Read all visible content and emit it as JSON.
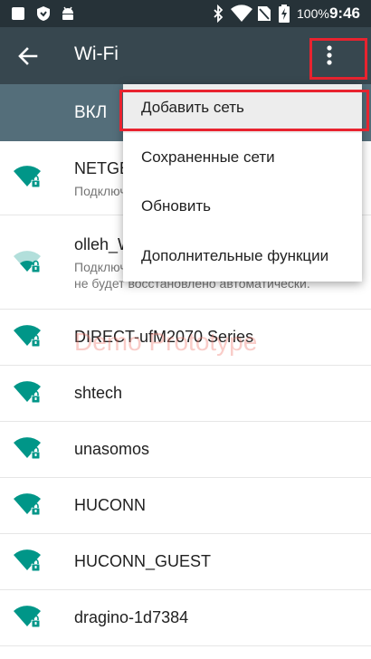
{
  "status_bar": {
    "icons": [
      "notification-icon",
      "shield-icon",
      "android-icon",
      "bluetooth-icon",
      "wifi-icon",
      "no-sim-icon",
      "battery-charging-icon"
    ],
    "battery": "100%",
    "time": "9:46"
  },
  "app_bar": {
    "title": "Wi-Fi",
    "back_icon": "arrow-back-icon",
    "overflow_icon": "more-vert-icon"
  },
  "switch": {
    "label": "ВКЛ"
  },
  "networks": [
    {
      "name": "NETGEAR",
      "status": "Подключ",
      "signal": "full",
      "locked": true
    },
    {
      "name": "olleh_WiFi",
      "status": "Подключ",
      "status_line2": "не будет восстановлено автоматически.",
      "signal": "weak",
      "locked": true
    },
    {
      "name": "DIRECT-ufM2070 Series",
      "signal": "full",
      "locked": true
    },
    {
      "name": "shtech",
      "signal": "full",
      "locked": true
    },
    {
      "name": "unasomos",
      "signal": "full",
      "locked": true
    },
    {
      "name": "HUCONN",
      "signal": "full",
      "locked": true
    },
    {
      "name": "HUCONN_GUEST",
      "signal": "full",
      "locked": true
    },
    {
      "name": "dragino-1d7384",
      "signal": "full",
      "locked": true
    }
  ],
  "watermark": "Demo Prototype",
  "menu": {
    "items": [
      {
        "label": "Добавить сеть",
        "selected": true
      },
      {
        "label": "Сохраненные сети"
      },
      {
        "label": "Обновить"
      },
      {
        "label": "Дополнительные функции"
      }
    ]
  },
  "colors": {
    "status_bar": "#263238",
    "app_bar": "#37474f",
    "switch_bar": "#546e7a",
    "accent": "#009688",
    "highlight": "#e8232f"
  }
}
